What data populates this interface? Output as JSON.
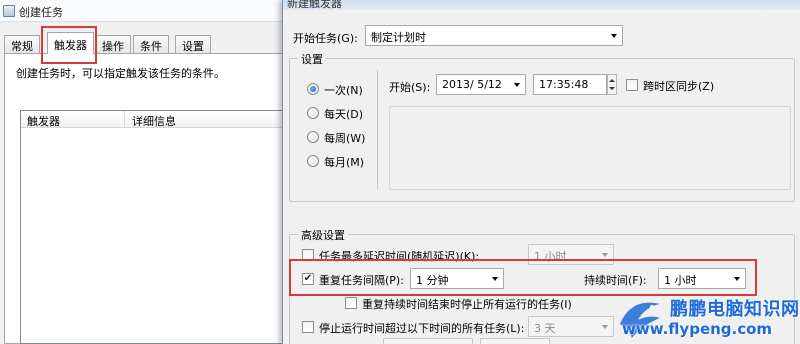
{
  "bg_window": {
    "title": "创建任务",
    "tabs": [
      "常规",
      "触发器",
      "操作",
      "条件",
      "设置"
    ],
    "active_tab": "触发器",
    "description": "创建任务时，可以指定触发该任务的条件。",
    "list_headers": [
      "触发器",
      "详细信息"
    ]
  },
  "dialog": {
    "title": "新建触发器",
    "begin_task_label": "开始任务(G):",
    "begin_task_value": "制定计划时",
    "settings_group": "设置",
    "schedule_options": [
      "一次(N)",
      "每天(D)",
      "每周(W)",
      "每月(M)"
    ],
    "schedule_selected": "一次(N)",
    "start_label": "开始(S):",
    "start_date": "2013/  5/12",
    "start_time": "17:35:48",
    "sync_tz_label": "跨时区同步(Z)",
    "advanced_group": "高级设置",
    "delay_label": "任务最多延迟时间(随机延迟)(K):",
    "delay_value": "1 小时",
    "repeat_label": "重复任务间隔(P):",
    "repeat_value": "1 分钟",
    "duration_label": "持续时间(F):",
    "duration_value": "1 小时",
    "stop_at_end_label": "重复持续时间结束时停止所有运行的任务(I)",
    "stop_longer_label": "停止运行时间超过以下时间的所有任务(L):",
    "stop_longer_value": "3 天"
  },
  "watermark": {
    "name": "鹏鹏电脑知识网",
    "url": "www.flypeng.com"
  },
  "colors": {
    "highlight_red": "#d23c3c",
    "watermark_blue": "#1d6ad8"
  }
}
